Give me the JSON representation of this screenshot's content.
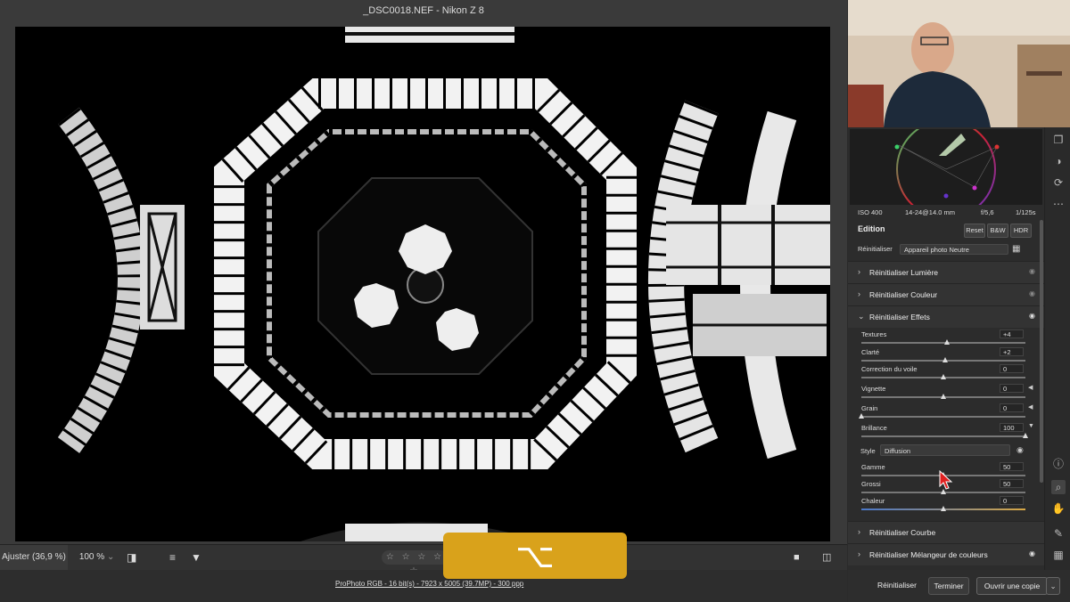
{
  "window": {
    "title": "_DSC0018.NEF  -  Nikon Z 8"
  },
  "bottom_toolbar": {
    "zoom_fit": "Ajuster (36,9 %)",
    "zoom_100": "100 %",
    "rating_stars": "☆ ☆ ☆ ☆ ☆"
  },
  "status": {
    "file_info": "ProPhoto RGB - 16 bit(s) - 7923 x 5005 (39.7MP) - 300 ppp"
  },
  "key_overlay": {
    "symbol": "⌥"
  },
  "exif": {
    "iso": "ISO 400",
    "lens": "14-24@14.0 mm",
    "aperture": "f/5,6",
    "shutter": "1/125s"
  },
  "edit_panel": {
    "title": "Edition",
    "buttons": {
      "reset": "Reset",
      "bw": "B&W",
      "hdr": "HDR"
    },
    "profile_label": "Réinitialiser",
    "profile_value": "Appareil photo Neutre",
    "sections": {
      "light": "Réinitialiser Lumière",
      "color": "Réinitialiser Couleur",
      "effects": "Réinitialiser Effets",
      "curve": "Réinitialiser Courbe",
      "mixer": "Réinitialiser Mélangeur de couleurs"
    },
    "sliders": {
      "textures": {
        "label": "Textures",
        "value": "+4",
        "level": 0.52
      },
      "clarte": {
        "label": "Clarté",
        "value": "+2",
        "level": 0.51
      },
      "voile": {
        "label": "Correction du voile",
        "value": "0",
        "level": 0.5
      },
      "vignette": {
        "label": "Vignette",
        "value": "0",
        "level": 0.5
      },
      "grain": {
        "label": "Grain",
        "value": "0",
        "level": 0.0
      },
      "brillance": {
        "label": "Brillance",
        "value": "100",
        "level": 1.0
      },
      "gamme": {
        "label": "Gamme",
        "value": "50",
        "level": 0.5
      },
      "grossi": {
        "label": "Grossi",
        "value": "50",
        "level": 0.5
      },
      "chaleur": {
        "label": "Chaleur",
        "value": "0",
        "level": 0.5
      }
    },
    "style_label": "Style",
    "style_value": "Diffusion"
  },
  "footer_buttons": {
    "reset": "Réinitialiser",
    "done": "Terminer",
    "save_copy": "Ouvrir une copie"
  },
  "colors": {
    "accent": "#d9a21b",
    "panel_bg": "#2c2c2c",
    "photo_bg": "#000000"
  }
}
